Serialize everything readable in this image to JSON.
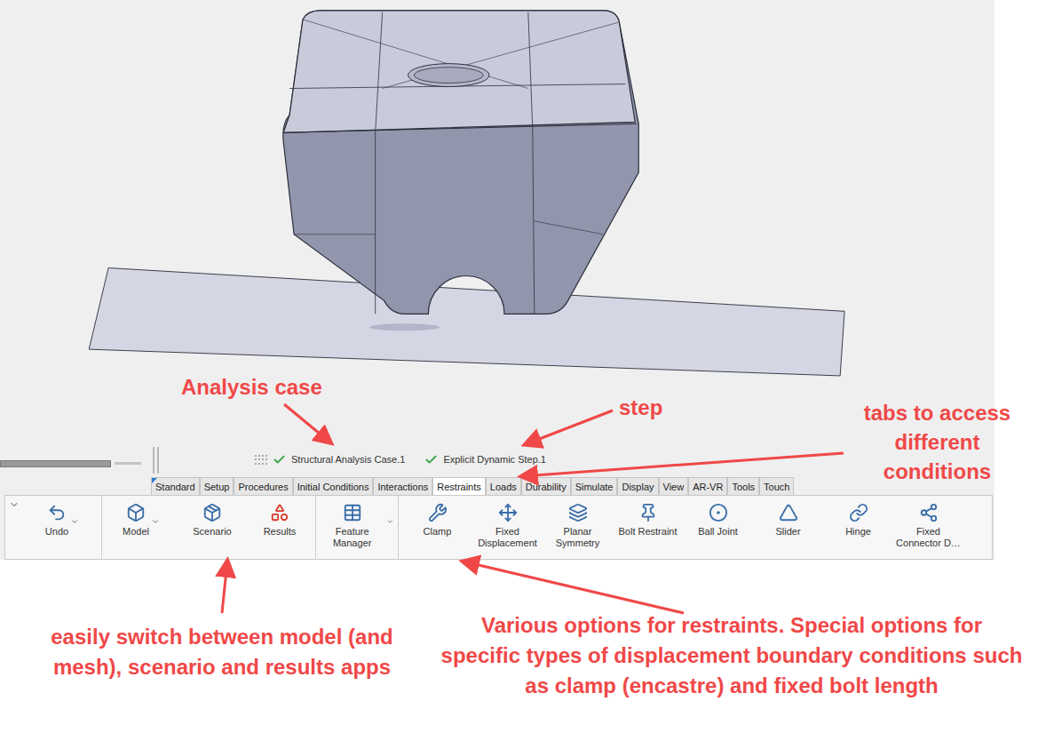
{
  "viewport": {
    "status": [
      {
        "label": "Structural Analysis Case.1",
        "done": true
      },
      {
        "label": "Explicit Dynamic Step.1",
        "done": true
      }
    ]
  },
  "tabs": [
    {
      "label": "Standard",
      "selected": false
    },
    {
      "label": "Setup",
      "selected": false
    },
    {
      "label": "Procedures",
      "selected": false
    },
    {
      "label": "Initial Conditions",
      "selected": false
    },
    {
      "label": "Interactions",
      "selected": false
    },
    {
      "label": "Restraints",
      "selected": true
    },
    {
      "label": "Loads",
      "selected": false
    },
    {
      "label": "Durability",
      "selected": false
    },
    {
      "label": "Simulate",
      "selected": false
    },
    {
      "label": "Display",
      "selected": false
    },
    {
      "label": "View",
      "selected": false
    },
    {
      "label": "AR-VR",
      "selected": false
    },
    {
      "label": "Tools",
      "selected": false
    },
    {
      "label": "Touch",
      "selected": false
    }
  ],
  "toolbar": {
    "app_groups": [
      [
        {
          "label": "Undo",
          "dropdown": true
        }
      ],
      [
        {
          "label": "Model",
          "dropdown": true
        },
        {
          "label": "Scenario",
          "dropdown": false
        },
        {
          "label": "Results",
          "dropdown": false
        }
      ],
      [
        {
          "label": "Feature Manager",
          "dropdown": true
        }
      ]
    ],
    "restraints": [
      {
        "label": "Clamp"
      },
      {
        "label": "Fixed Displacement"
      },
      {
        "label": "Planar Symmetry"
      },
      {
        "label": "Bolt Restraint"
      },
      {
        "label": "Ball Joint"
      },
      {
        "label": "Slider"
      },
      {
        "label": "Hinge"
      },
      {
        "label": "Fixed Connector D…"
      }
    ]
  },
  "annotations": {
    "analysis_case": "Analysis case",
    "step": "step",
    "tabs": "tabs to access different conditions",
    "apps": "easily switch between model (and mesh), scenario and results apps",
    "restraints": "Various options for restraints. Special options for specific types of displacement boundary conditions such as clamp (encastre) and fixed bolt length"
  }
}
